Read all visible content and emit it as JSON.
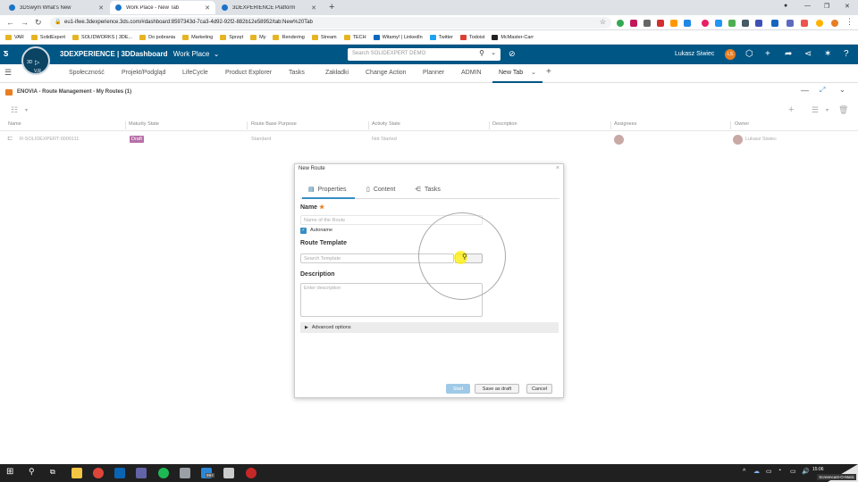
{
  "browser": {
    "tabs": [
      {
        "title": "3DSwym What's New",
        "active": false
      },
      {
        "title": "Work Place - New Tab",
        "active": true
      },
      {
        "title": "3DEXPERIENCE Platform",
        "active": false
      }
    ],
    "url": "eu1-ifwe.3dexperience.3ds.com/#dashboard:8597343d-7ca3-4d92-92f2-882b12e58952/tab:New%20Tab",
    "bookmarks": [
      "VAR",
      "SolidExpert",
      "SOLIDWORKS | 3DE...",
      "Do pobrania",
      "Marketing",
      "Sprzęt",
      "My",
      "Rendering",
      "Stream",
      "TECH",
      "Witamy! | LinkedIn",
      "Twitter",
      "Todoist",
      "McMaster-Carr"
    ]
  },
  "header": {
    "brand": "3DEXPERIENCE | 3DDashboard",
    "dashboard": "Work Place",
    "search_placeholder": "Search SOLIDEXPERT DEMO",
    "user": "Lukasz Siwiec",
    "user_initials": "LS",
    "compass_labels": [
      "3D",
      "V,R"
    ]
  },
  "dashboard_tabs": [
    "Społeczność",
    "Projekt/Podgląd",
    "LifeCycle",
    "Product Explorer",
    "Tasks",
    "Zakładki",
    "Change Action",
    "Planner",
    "ADMIN",
    "New Tab"
  ],
  "widget": {
    "title": "ENOVIA - Route Management - My Routes (1)"
  },
  "grid": {
    "columns": [
      "Name",
      "Maturity State",
      "Route Base Purpose",
      "Activity State",
      "Description",
      "Assignees",
      "Owner"
    ],
    "rows": [
      {
        "name": "R-SOLIDEXPERT-0000111",
        "maturity": "Draft",
        "purpose": "Standard",
        "activity": "Not Started",
        "description": "",
        "owner": "Lukasz Siwiec"
      }
    ]
  },
  "dialog": {
    "title": "New Route",
    "tabs": [
      "Properties",
      "Content",
      "Tasks"
    ],
    "name_label": "Name",
    "name_placeholder": "Name of the Route",
    "autoname_label": "Autoname",
    "autoname_checked": true,
    "template_label": "Route Template",
    "template_placeholder": "Search Template",
    "description_label": "Description",
    "description_placeholder": "Enter description",
    "advanced_label": "Advanced options",
    "buttons": {
      "start": "Start",
      "draft": "Save as draft",
      "cancel": "Cancel"
    }
  },
  "taskbar": {
    "time": "15:06",
    "badge": "99+",
    "screencast": "Screencast-O-Matic"
  },
  "colors": {
    "header": "#005685",
    "accent": "#368ec4",
    "highlight": "#fff000"
  }
}
